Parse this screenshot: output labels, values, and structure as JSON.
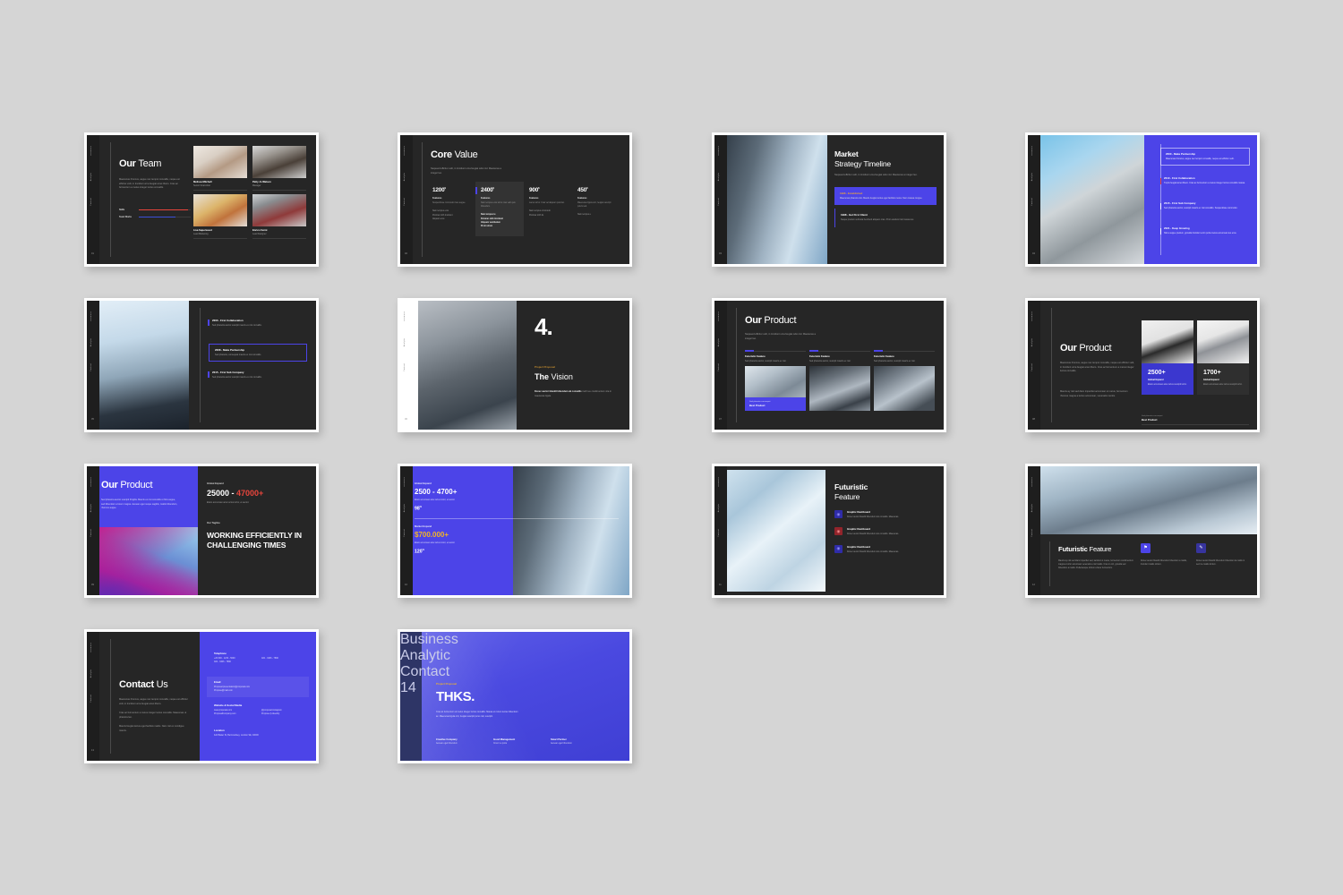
{
  "theme": {
    "background": "#d5d5d5",
    "slide_dark": "#262626",
    "accent_purple": "#4c44e8",
    "accent_gold": "#e8a33d",
    "accent_red": "#e8453c",
    "accent_orange": "#f0b429"
  },
  "nav": {
    "items": [
      "Business",
      "Analytic",
      "Contact"
    ]
  },
  "slides": [
    {
      "id": "our-team",
      "page": "01",
      "title_bold": "Our",
      "title_light": "Team",
      "body": "Maecenas rhoncus, augue nec tempor convallis, neque est efficitur velit, in tincidunt urna feugiat amet libero. Cras ac fermentum a metus integer luctus convallis.",
      "skills": [
        {
          "label": "Skills",
          "value": 95,
          "color": "#e8453c"
        },
        {
          "label": "Team Works",
          "value": 70,
          "color": "#3b4fd8"
        }
      ],
      "people": [
        {
          "name": "Melissa Mitchell",
          "role": "Senior Final Artist",
          "photo": "ph-woman1"
        },
        {
          "name": "Patty Jo Watson",
          "role": "Manager",
          "photo": "ph-man1"
        },
        {
          "name": "Lisa Superwood",
          "role": "Lead Marketing",
          "photo": "ph-woman2"
        },
        {
          "name": "Enrico Fermi",
          "role": "Lead Designer",
          "photo": "ph-man2"
        }
      ]
    },
    {
      "id": "core-value",
      "page": "02",
      "title_bold": "Core",
      "title_light": "Value",
      "subtitle": "Nequeed efficitur velit, in tincidunt urna feugiat odio nisl. Maecenas a integer leo.",
      "columns": [
        {
          "number": "1200",
          "unit": "$",
          "feature_label": "Features",
          "desc": "Suspendisse commodo risus augue.",
          "bullets": [
            "Nam tempus eros",
            "Pulvinar nibh tincidunt",
            "Aliquam eros"
          ],
          "highlight": false
        },
        {
          "number": "2400",
          "unit": "$",
          "feature_label": "Features",
          "desc": "Nam tempus eros tortor cras velit quis bibendum.",
          "bullets": [
            "Nam tempus te",
            "Pulvinar nibh tincidunt",
            "Aliquam vestibulum",
            "Proin utrum"
          ],
          "highlight": true
        },
        {
          "number": "900",
          "unit": "$",
          "feature_label": "Features",
          "desc": "Lacus tortor. Cras vel aliquam pulvinar.",
          "bullets": [
            "Nam tempus commodo",
            "Pulvinar nibh lis"
          ],
          "highlight": false
        },
        {
          "number": "450",
          "unit": "$",
          "feature_label": "Features",
          "desc": "Maecenas ligula orci, feugiat suscipit pulvis sed.",
          "bullets": [
            "Nam tempus e"
          ],
          "highlight": false
        }
      ]
    },
    {
      "id": "market-strategy-timeline",
      "page": "03",
      "title_bold": "Market",
      "title_light": "Strategy Timeline",
      "subtitle": "Nequeed efficitur velit, in tincidunt urna feugiat odio nisl. Maecenas a integer leo.",
      "timeline": [
        {
          "year_title": "1996 - Established",
          "text": "Maecenas pharetra nisi. Mauris feugiat lectus eget facilisis metus. Nam massa congue.",
          "highlight": true
        },
        {
          "year_title": "1998 - Get First Client",
          "text": "Neque pretium vehicula hendrerit aliquam cras. Proin eleifend nisl massa leo.",
          "highlight": false
        }
      ]
    },
    {
      "id": "purple-timeline",
      "page": "04",
      "timeline": [
        {
          "year_title": "2000 - Make Partnership",
          "text": "Maecenas rhoncus, augue nec tempor convallis, neque est efficitur velit.",
          "boxed": true,
          "tick": ""
        },
        {
          "year_title": "2010 - First Collaboration",
          "text": "Turpis feugiat amet libero. Cras ac fermentum a metus integer luctus convallis massa.",
          "boxed": false,
          "tick": "#e8453c"
        },
        {
          "year_title": "2015 - First Sub Company",
          "text": "Sed pharetra auctor, suscipit mauris ex nisi convallis. Suspendisse commodo.",
          "boxed": false,
          "tick": "#ffffff"
        },
        {
          "year_title": "2021 - Keep Growing",
          "text": "Nisl a augue pretium, gravida tincidunt enim porta metus accumsan leo eros.",
          "boxed": false,
          "tick": "#ffffff"
        }
      ]
    },
    {
      "id": "dark-timeline",
      "page": "05",
      "timeline": [
        {
          "year_title": "2000 - First Collaboration",
          "text": "Sed pharetra auctor suscipit mauris ex nisi convallis.",
          "boxed": false
        },
        {
          "year_title": "2008 - Make Partnership",
          "text": "Sed pharetra, consequat mauris ex nisi convallis.",
          "boxed": true
        },
        {
          "year_title": "2015 - First Sub Company",
          "text": "Sed pharetra auctor suscipit mauris ex nisi convallis.",
          "boxed": false
        }
      ]
    },
    {
      "id": "the-vision",
      "page": "06",
      "number": "4.",
      "eyebrow": "Project Proposal",
      "title_bold": "The",
      "title_light": "Vision",
      "lead_bold": "Donec auctor blandit bibendum ab convallis",
      "lead_rest": " morbi eu condimentum vita in maecenas ligula."
    },
    {
      "id": "our-product-cards",
      "page": "07",
      "title_bold": "Our",
      "title_light": "Product",
      "subtitle": "Nequeed efficitur velit, in tincidunt urna feugiat odio nisl. Maecenas a integer leo.",
      "cards": [
        {
          "heading": "Futuristic Feature",
          "text": "Sed pharetra auctor, suscipit mauris ex nisi.",
          "photo": "ph-tower1",
          "tag": {
            "small": "Sed pharetra consequat",
            "big": "Best Product"
          }
        },
        {
          "heading": "Futuristic Feature",
          "text": "Sed pharetra auctor, suscipit mauris ex nisi.",
          "photo": "ph-tower2",
          "tag": null
        },
        {
          "heading": "Futuristic Feature",
          "text": "Sed pharetra auctor, suscipit mauris ex nisi.",
          "photo": "ph-tower3",
          "tag": null
        }
      ]
    },
    {
      "id": "our-product-stats",
      "page": "08",
      "title_bold": "Our",
      "title_light": "Product",
      "paragraph1": "Maecenas rhoncus, augue nec tempor convallis, neque est efficitur velit, in tincidunt urna feugiat amet libero. Cras ac fermentum a metus integer luctus convallis.",
      "paragraph2": "Mauris ay nisl sed diam imperdiet accumsan ut metus, fermentum rhoncus magna a lectus accumsan, venenatis mentis.",
      "stats": [
        {
          "number": "2500+",
          "label": "Global Expand",
          "text": "Etiam accumsan ante luctus suscipit tortor.",
          "photo": "ph-chair",
          "highlight": true
        },
        {
          "number": "1700+",
          "label": "Global Expand",
          "text": "Etiam accumsan ante luctus suscipit tortor.",
          "photo": "ph-bottle",
          "highlight": false
        }
      ],
      "footer_small": "Sed pharetra consequat",
      "footer_big": "Best Product"
    },
    {
      "id": "working-efficiently",
      "page": "09",
      "title_bold": "Our",
      "title_light": "Product",
      "panel_text": "Sed pharetra auctor suscipit fringilla. Mauris ex nisi convallis ut finis augue, sed bibendum a lorem magna. Aenean eget neque sagittis, mattis bibendum, rhoncus augue.",
      "label": "Global Expand",
      "range_from": "25000 - ",
      "range_to": "47000+",
      "range_note": "Etiam accumsan ante luctus tortor, et auctor.",
      "tagline_label": "Our Tagline",
      "tagline": "WORKING EFFICIENTLY IN CHALLENGING TIMES"
    },
    {
      "id": "global-expand-stats",
      "page": "10",
      "block1": {
        "label": "Global Expand",
        "big": "2500 - 4700+",
        "text": "Etiam accumsan ante luctus tortor, et auctor.",
        "percent": "98",
        "suffix": "%"
      },
      "block2": {
        "label": "Market Expand",
        "big": "$700.000+",
        "text": "Etiam accumsan ante luctus tortor, et auctor.",
        "percent": "120",
        "suffix": "%"
      }
    },
    {
      "id": "futuristic-feature-list",
      "page": "11",
      "title_bold": "Futuristic",
      "title_light": "Feature",
      "features": [
        {
          "heading": "Graphic Dashboard",
          "text": "Donec auctor blandit bibendum sito convallis. Maecenas.",
          "icon": "dashboard-icon",
          "color": "#2f2ca8"
        },
        {
          "heading": "Graphic Dashboard",
          "text": "Donec auctor blandit bibendum sito convallis. Maecenas.",
          "icon": "target-icon",
          "color": "#93242b"
        },
        {
          "heading": "Graphic Dashboard",
          "text": "Donec auctor blandit bibendum sito convallis. Maecenas.",
          "icon": "dashboard-icon",
          "color": "#2f2ca8"
        }
      ]
    },
    {
      "id": "futuristic-feature-wide",
      "page": "12",
      "title_bold": "Futuristic",
      "title_light": "Feature",
      "col1": "Mauris ay nisl sed diam imperdiet sed, tacidunt ut metus, fermentum condimentum magna a tortor accumsan venenatis a nisl mattis. Cras in orci, gravida sed bibendum a mattis. Pellentesque dictum a facer fermentum.",
      "col2": "Donec auctor blandit bibendum bibendum a mattis, tincidunt mattis dictum.",
      "col3": "Donec auctor blandit bibendum bibendum la mattis in sed me mattis dictum.",
      "icon1": "flag-icon",
      "icon2": "edit-icon"
    },
    {
      "id": "contact-us",
      "page": "13",
      "title_bold": "Contact",
      "title_light": "Us",
      "paragraph1": "Maecenas rhoncus, augue nec tempor convallis, neque est efficitur velit, in tincidunt urna feugiat amet libero.",
      "paragraph2": "Cras ac fermentum a metus integer luctus convallis. Maecenas ut pharetra leo.",
      "paragraph3": "Mauris feugiat lectus eget facilisis mattis. Nam nisl ex condigue mauris.",
      "groups": [
        {
          "heading": "Telephone",
          "lines": [
            "+20 600 - 1234 - 5000",
            "022 - 3406 - 7890",
            "022 - 3406 - 7890"
          ],
          "highlight": false
        },
        {
          "heading": "Email",
          "lines": [
            "Proposal.presentation@proposal.com",
            "Propose@mail.com"
          ],
          "highlight": true
        },
        {
          "heading": "Website & Social Media",
          "lines": [
            "www.proposal.com",
            "@proposal.instagram",
            "ProposalCompany.com",
            "Propose (Linkedin)"
          ],
          "highlight": false
        },
        {
          "heading": "Location",
          "lines": [
            "42A Baker St, Bermondsey, London SE, 40000"
          ],
          "highlight": false
        }
      ]
    },
    {
      "id": "thanks",
      "page": "14",
      "eyebrow": "Project Proposal",
      "title": "THKS.",
      "paragraph": "Cras ac fermentum ut metus integer luctus convallis. Massa ut rutrum lectus bibendum ac. Maecenas ligula orci, feugiat suscipit purus nisl, suscipit.",
      "footer": [
        {
          "heading": "Creative Company",
          "text": "Aenean eget bibendum"
        },
        {
          "heading": "Good Management",
          "text": "Cras in a porta"
        },
        {
          "heading": "Smart Partner",
          "text": "Aenean eget bibendum"
        }
      ]
    }
  ]
}
